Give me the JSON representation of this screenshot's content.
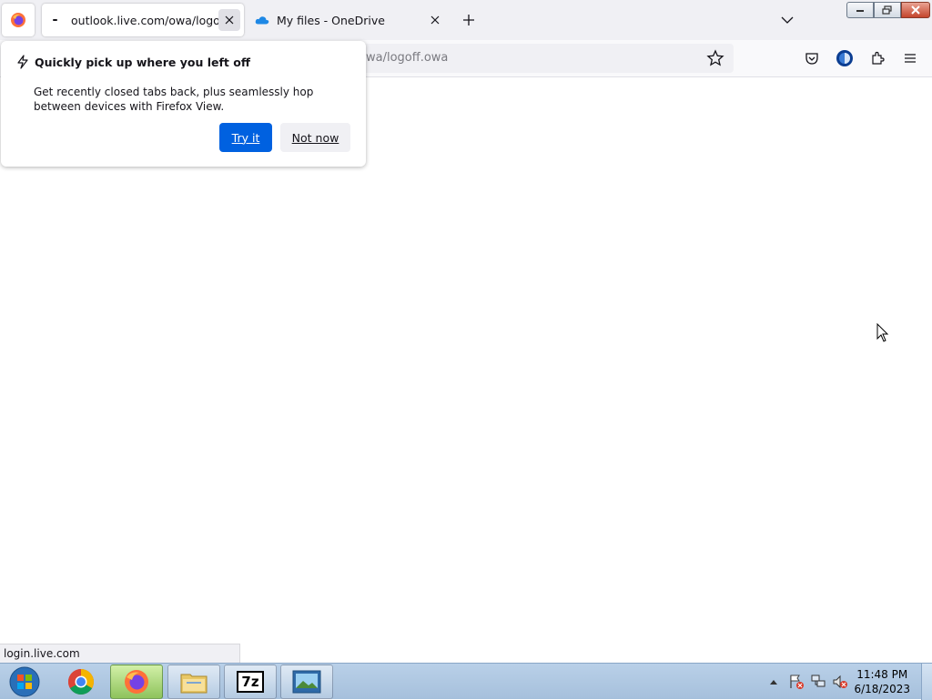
{
  "browser": {
    "tabs": [
      {
        "title": "outlook.live.com/owa/logoff.owa",
        "active": true
      },
      {
        "title": "My files - OneDrive",
        "active": false
      }
    ],
    "url_visible": "wa/logoff.owa",
    "status_text": "login.live.com"
  },
  "popup": {
    "heading": "Quickly pick up where you left off",
    "body": "Get recently closed tabs back, plus seamlessly hop between devices with Firefox View.",
    "primary_label": "Try it",
    "secondary_label": "Not now"
  },
  "taskbar": {
    "apps": [
      "chrome-icon",
      "firefox-icon",
      "file-explorer-icon",
      "7zip-icon",
      "image-viewer-icon"
    ],
    "seven_zip_label": "7z",
    "clock_time": "11:48 PM",
    "clock_date": "6/18/2023"
  },
  "colors": {
    "accent": "#0061e0",
    "tabstrip": "#f0f0f4",
    "taskbar": "#b9d0e8"
  }
}
